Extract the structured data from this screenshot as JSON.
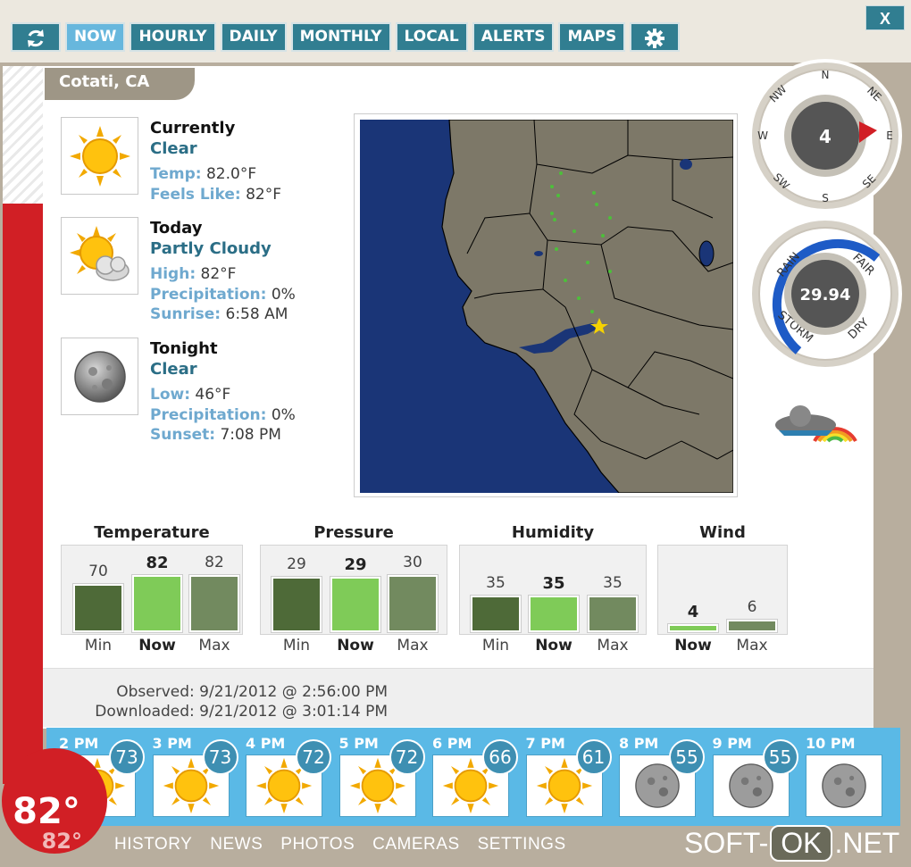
{
  "nav": {
    "refresh_icon": "refresh-icon",
    "items": [
      "NOW",
      "HOURLY",
      "DAILY",
      "MONTHLY",
      "LOCAL",
      "ALERTS",
      "MAPS"
    ],
    "settings_icon": "gear-icon",
    "close_label": "X",
    "active": "NOW"
  },
  "location": "Cotati, CA",
  "conditions": [
    {
      "heading": "Currently",
      "summary": "Clear",
      "icon": "sun-icon",
      "lines": [
        {
          "label": "Temp:",
          "value": "82.0°F"
        },
        {
          "label": "Feels Like:",
          "value": "82°F"
        }
      ]
    },
    {
      "heading": "Today",
      "summary": "Partly Cloudy",
      "icon": "partly-cloudy-icon",
      "lines": [
        {
          "label": "High:",
          "value": "82°F"
        },
        {
          "label": "Precipitation:",
          "value": "0%"
        },
        {
          "label": "Sunrise:",
          "value": "6:58 AM"
        }
      ]
    },
    {
      "heading": "Tonight",
      "summary": "Clear",
      "icon": "moon-icon",
      "lines": [
        {
          "label": "Low:",
          "value": "46°F"
        },
        {
          "label": "Precipitation:",
          "value": "0%"
        },
        {
          "label": "Sunset:",
          "value": "7:08 PM"
        }
      ]
    }
  ],
  "compass": {
    "labels": [
      "N",
      "NE",
      "E",
      "SE",
      "S",
      "SW",
      "W",
      "NW"
    ],
    "speed": "4",
    "direction": "E"
  },
  "barometer": {
    "value": "29.94",
    "labels": [
      "RAIN",
      "FAIR",
      "STORM",
      "DRY"
    ]
  },
  "stats": [
    {
      "title": "Temperature",
      "bars": [
        {
          "label": "Min",
          "value": "70",
          "level": 70
        },
        {
          "label": "Now",
          "value": "82",
          "level": 82
        },
        {
          "label": "Max",
          "value": "82",
          "level": 82
        }
      ]
    },
    {
      "title": "Pressure",
      "bars": [
        {
          "label": "Min",
          "value": "29",
          "level": 29
        },
        {
          "label": "Now",
          "value": "29",
          "level": 29
        },
        {
          "label": "Max",
          "value": "30",
          "level": 30
        }
      ]
    },
    {
      "title": "Humidity",
      "bars": [
        {
          "label": "Min",
          "value": "35",
          "level": 35
        },
        {
          "label": "Now",
          "value": "35",
          "level": 35
        },
        {
          "label": "Max",
          "value": "35",
          "level": 35
        }
      ]
    },
    {
      "title": "Wind",
      "bars": [
        {
          "label": "Now",
          "value": "4",
          "level": 4
        },
        {
          "label": "Max",
          "value": "6",
          "level": 6
        }
      ]
    }
  ],
  "observed": "Observed: 9/21/2012 @ 2:56:00 PM",
  "downloaded": "Downloaded: 9/21/2012 @ 3:01:14 PM",
  "hourly": [
    {
      "time": "2 PM",
      "temp": "73",
      "icon": "sun-icon"
    },
    {
      "time": "3 PM",
      "temp": "73",
      "icon": "sun-icon"
    },
    {
      "time": "4 PM",
      "temp": "72",
      "icon": "sun-icon"
    },
    {
      "time": "5 PM",
      "temp": "72",
      "icon": "sun-icon"
    },
    {
      "time": "6 PM",
      "temp": "66",
      "icon": "sun-icon"
    },
    {
      "time": "7 PM",
      "temp": "61",
      "icon": "sun-icon"
    },
    {
      "time": "8 PM",
      "temp": "55",
      "icon": "moon-icon"
    },
    {
      "time": "9 PM",
      "temp": "55",
      "icon": "moon-icon"
    },
    {
      "time": "10 PM",
      "temp": "",
      "icon": "moon-icon"
    }
  ],
  "current_temp": "82°",
  "current_temp_feels": "82°",
  "bottom_links": [
    "HISTORY",
    "NEWS",
    "PHOTOS",
    "CAMERAS",
    "SETTINGS"
  ],
  "watermark": {
    "left": "SOFT-",
    "mid": "OK",
    "right": ".NET"
  },
  "colors": {
    "accent": "#317e91",
    "active": "#67b7dd",
    "min_bar": "#4e6a38",
    "now_bar": "#7fcb58",
    "max_bar": "#728a5f",
    "thermo": "#d11f25"
  }
}
